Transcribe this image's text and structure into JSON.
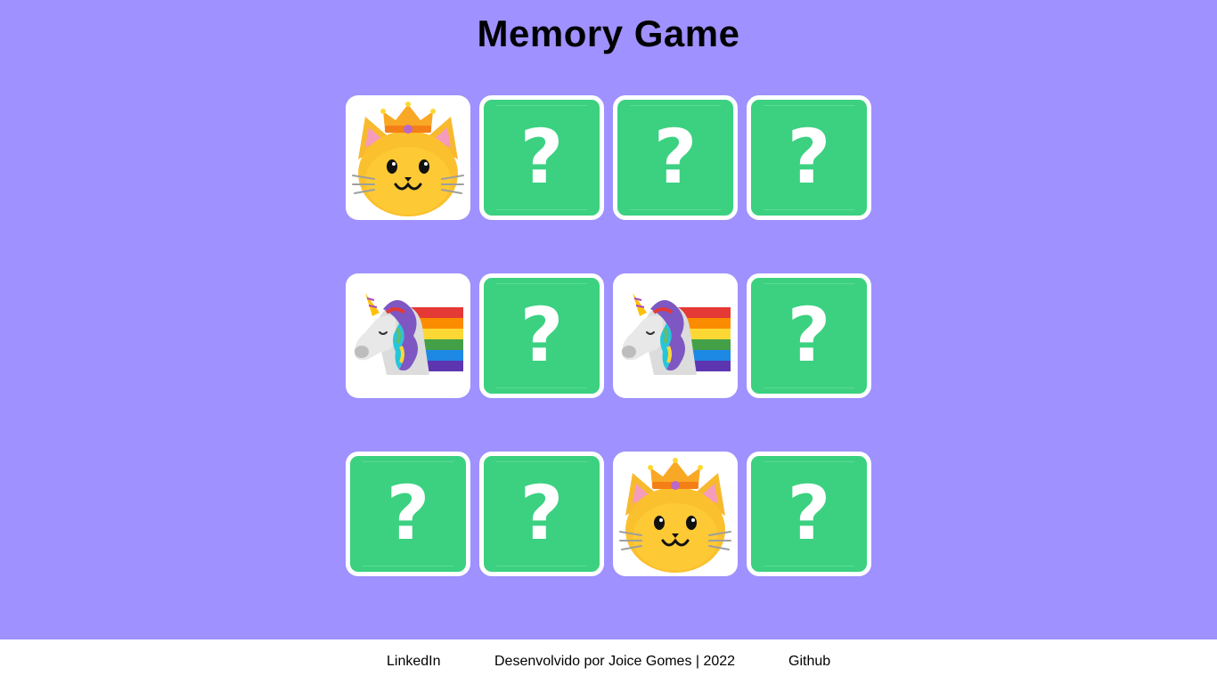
{
  "title": "Memory Game",
  "board": {
    "rows": 3,
    "cols": 4,
    "cards": [
      {
        "state": "revealed",
        "face": "cat-with-crown"
      },
      {
        "state": "hidden",
        "face": "?"
      },
      {
        "state": "hidden",
        "face": "?"
      },
      {
        "state": "hidden",
        "face": "?"
      },
      {
        "state": "revealed",
        "face": "rainbow-unicorn"
      },
      {
        "state": "hidden",
        "face": "?"
      },
      {
        "state": "revealed",
        "face": "rainbow-unicorn"
      },
      {
        "state": "hidden",
        "face": "?"
      },
      {
        "state": "hidden",
        "face": "?"
      },
      {
        "state": "hidden",
        "face": "?"
      },
      {
        "state": "revealed",
        "face": "cat-with-crown"
      },
      {
        "state": "hidden",
        "face": "?"
      }
    ]
  },
  "footer": {
    "linkedin": "LinkedIn",
    "credits": "Desenvolvido por Joice Gomes | 2022",
    "github": "Github"
  },
  "colors": {
    "background": "#9f91ff",
    "card_back": "#3bd181",
    "card_border": "#ffffff"
  }
}
